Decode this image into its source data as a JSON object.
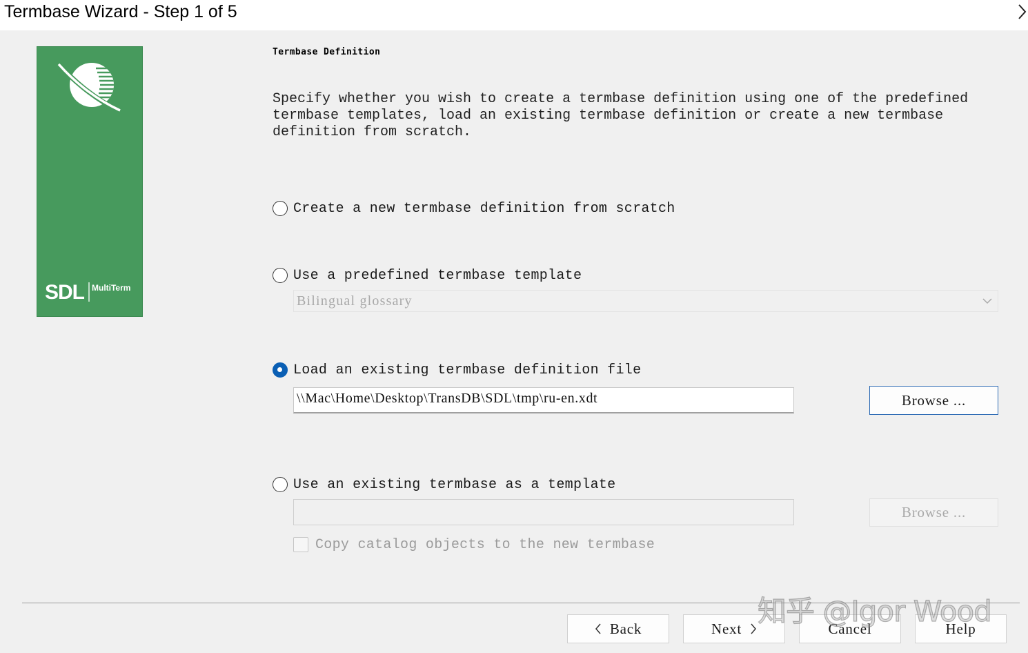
{
  "window": {
    "title": "Termbase Wizard - Step 1 of 5"
  },
  "banner": {
    "brand": "SDL",
    "product": "MultiTerm",
    "background_color": "#479a5d"
  },
  "section": {
    "heading": "Termbase Definition",
    "description_lines": [
      "Specify whether you wish to create a termbase definition using one of the predefined",
      "termbase templates, load an existing termbase definition or create a new termbase",
      "definition from scratch."
    ]
  },
  "options": {
    "create_new": {
      "label": "Create a new termbase definition from scratch",
      "selected": false
    },
    "predefined": {
      "label": "Use a predefined termbase template",
      "selected": false,
      "template_value": "Bilingual glossary"
    },
    "load_existing": {
      "label": "Load an existing termbase definition file",
      "selected": true,
      "path_value": "\\\\Mac\\Home\\Desktop\\TransDB\\SDL\\tmp\\ru-en.xdt",
      "browse_label": "Browse ..."
    },
    "existing_termbase": {
      "label": "Use an existing termbase as a template",
      "selected": false,
      "path_value": "",
      "browse_label": "Browse ...",
      "copy_catalog_label": "Copy catalog objects to the new termbase",
      "copy_catalog_checked": false
    }
  },
  "footer": {
    "back_label": "Back",
    "next_label": "Next",
    "cancel_label": "Cancel",
    "help_label": "Help"
  },
  "watermark": "知乎 @Igor Wood",
  "colors": {
    "accent": "#0a5fb4",
    "default_button_border": "#2f6cb5",
    "disabled_text": "#a9a9a9"
  }
}
